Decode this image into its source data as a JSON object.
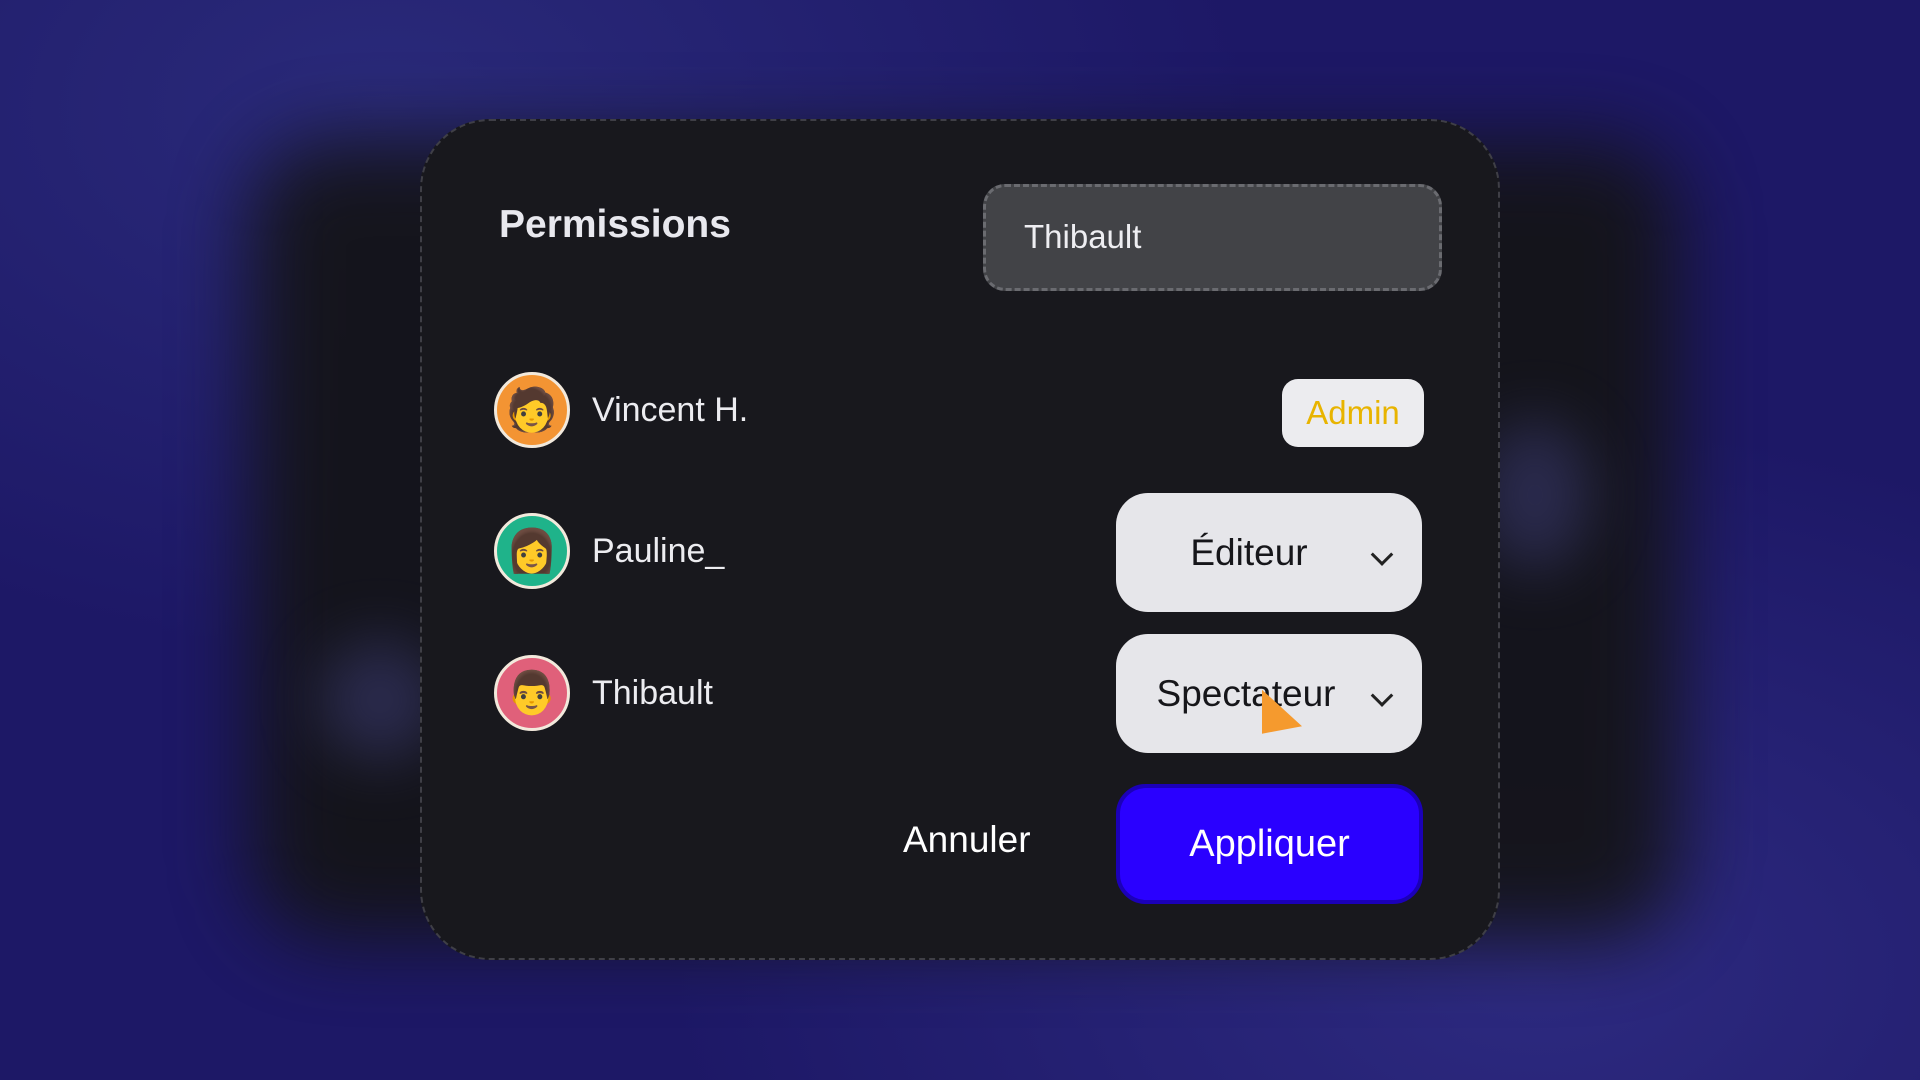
{
  "dialog": {
    "title": "Permissions",
    "search": {
      "value": "Thibault"
    },
    "users": [
      {
        "name": "Vincent H.",
        "avatar_icon": "memoji-man-glasses",
        "avatar_color": "#f39433",
        "role": "Admin",
        "role_type": "badge"
      },
      {
        "name": "Pauline_",
        "avatar_icon": "memoji-woman-lightbulb",
        "avatar_color": "#1fb38a",
        "role": "Éditeur",
        "role_type": "dropdown"
      },
      {
        "name": "Thibault",
        "avatar_icon": "memoji-man",
        "avatar_color": "#e0607a",
        "role": "Spectateur",
        "role_type": "dropdown"
      }
    ],
    "cancel_label": "Annuler",
    "apply_label": "Appliquer",
    "colors": {
      "accent": "#2a00ff",
      "admin": "#e8b400"
    }
  }
}
